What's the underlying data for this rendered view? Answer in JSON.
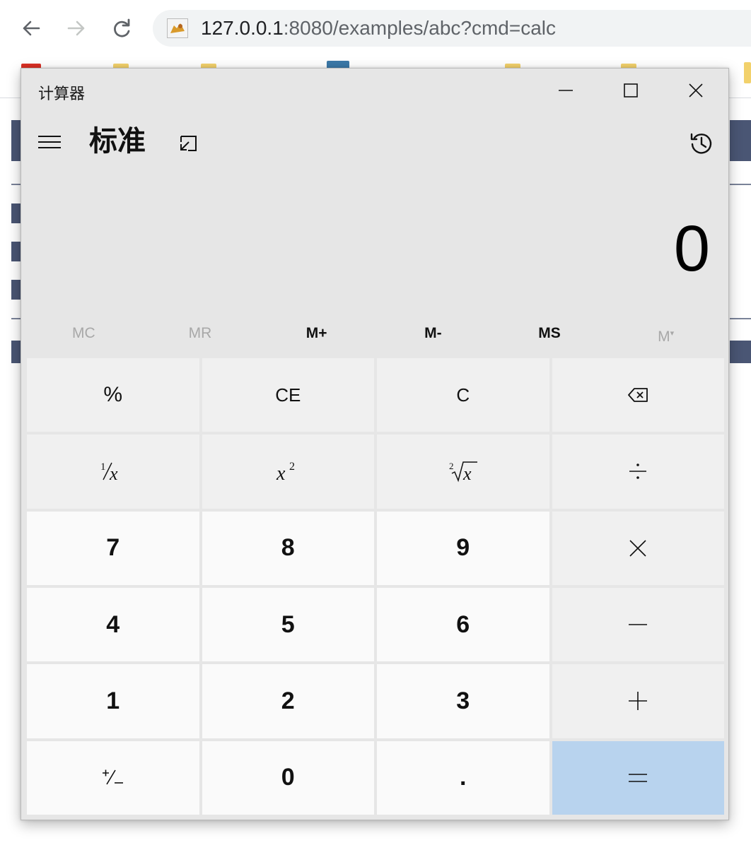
{
  "browser": {
    "url_host": "127.0.0.1",
    "url_rest": ":8080/examples/abc?cmd=calc"
  },
  "calculator": {
    "window_title": "计算器",
    "mode_title": "标准",
    "display": "0",
    "memory": {
      "mc": "MC",
      "mr": "MR",
      "m_plus": "M+",
      "m_minus": "M-",
      "ms": "MS",
      "m_list": "M"
    },
    "keys": {
      "percent": "%",
      "ce": "CE",
      "c": "C",
      "seven": "7",
      "eight": "8",
      "nine": "9",
      "four": "4",
      "five": "5",
      "six": "6",
      "one": "1",
      "two": "2",
      "three": "3",
      "zero": "0",
      "decimal": ".",
      "divide": "÷",
      "multiply": "×",
      "minus": "—",
      "plus": "+",
      "equals": "="
    },
    "colors": {
      "window_bg": "#e6e6e6",
      "digit_key_bg": "#fafafa",
      "function_key_bg": "#f0f0f0",
      "equals_bg": "#b8d3ee"
    }
  }
}
